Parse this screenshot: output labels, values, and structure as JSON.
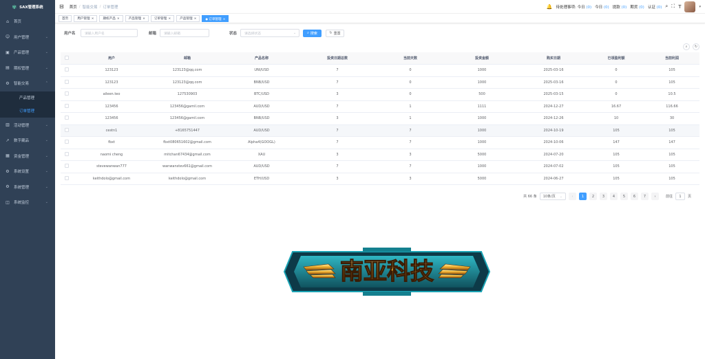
{
  "app": {
    "title": "SAX管理系统"
  },
  "sidebar": {
    "items": [
      {
        "label": "首页",
        "icon": "home-icon",
        "glyph": "⌂"
      },
      {
        "label": "用户管理",
        "icon": "user-icon",
        "glyph": "☺",
        "chevron": "⌄"
      },
      {
        "label": "产品管理",
        "icon": "box-icon",
        "glyph": "▣",
        "chevron": "⌄"
      },
      {
        "label": "期权管理",
        "icon": "chart-icon",
        "glyph": "▤",
        "chevron": "⌄"
      },
      {
        "label": "智能交易",
        "icon": "gear-icon",
        "glyph": "⚙",
        "chevron": "⌃"
      }
    ],
    "subitems": [
      {
        "label": "产品管理",
        "active": false
      },
      {
        "label": "订单管理",
        "active": true
      }
    ],
    "items_after": [
      {
        "label": "活动管理",
        "icon": "gift-icon",
        "glyph": "▥",
        "chevron": "⌄"
      },
      {
        "label": "数字藏品",
        "icon": "trend-icon",
        "glyph": "↗",
        "chevron": "⌄"
      },
      {
        "label": "资金管理",
        "icon": "wallet-icon",
        "glyph": "▦",
        "chevron": "⌄"
      },
      {
        "label": "系统设置",
        "icon": "settings-icon",
        "glyph": "⚙",
        "chevron": "⌄"
      },
      {
        "label": "系统管理",
        "icon": "system-icon",
        "glyph": "⚙",
        "chevron": "⌄"
      },
      {
        "label": "系统监控",
        "icon": "monitor-icon",
        "glyph": "◫",
        "chevron": "⌄"
      }
    ]
  },
  "navbar": {
    "breadcrumb": [
      "首页",
      "智能交易",
      "订单管理"
    ],
    "stats_prefix": "待处理事项: 今日",
    "stats": [
      {
        "label": "今日",
        "value": "(0)"
      },
      {
        "label": "提款",
        "value": "(0)"
      },
      {
        "label": "期货",
        "value": "(0)"
      },
      {
        "label": "认证",
        "value": "(0)"
      }
    ],
    "first_value": "(0)"
  },
  "tags": [
    {
      "label": "首页",
      "active": false,
      "closable": false
    },
    {
      "label": "用户管理",
      "active": false,
      "closable": true
    },
    {
      "label": "期权产品",
      "active": false,
      "closable": true
    },
    {
      "label": "产品管理",
      "active": false,
      "closable": true
    },
    {
      "label": "订单管理",
      "active": false,
      "closable": true
    },
    {
      "label": "产品管理",
      "active": false,
      "closable": true
    },
    {
      "label": "订单管理",
      "active": true,
      "closable": true
    }
  ],
  "filters": {
    "user_label": "用户名",
    "user_placeholder": "请输入用户名",
    "email_label": "邮箱",
    "email_placeholder": "请输入邮箱",
    "status_label": "状态",
    "status_placeholder": "请选择状态",
    "search_label": "搜索",
    "reset_label": "重置"
  },
  "table": {
    "columns": [
      "用户",
      "邮箱",
      "产品名称",
      "投资日期总数",
      "当前天数",
      "投资金额",
      "购买日期",
      "已领盈利额",
      "当前利润"
    ],
    "rows": [
      [
        "123123",
        "123123@qq.com",
        "UNI/USD",
        "7",
        "0",
        "1000",
        "2025-03-16",
        "0",
        "105"
      ],
      [
        "123123",
        "123123@qq.com",
        "BNB/USD",
        "7",
        "0",
        "1000",
        "2025-03-16",
        "0",
        "105"
      ],
      [
        "aileen.teo",
        "127530903",
        "BTC/USD",
        "3",
        "0",
        "500",
        "2025-03-15",
        "0",
        "10.5"
      ],
      [
        "123456",
        "123456@gamil.com",
        "AUD/USD",
        "7",
        "1",
        "1111",
        "2024-12-27",
        "16.67",
        "116.66"
      ],
      [
        "123456",
        "123456@gamil.com",
        "BNB/USD",
        "3",
        "1",
        "1000",
        "2024-12-26",
        "10",
        "30"
      ],
      [
        "cestn1",
        "+8165751447",
        "AUD/USD",
        "7",
        "7",
        "1000",
        "2024-10-19",
        "105",
        "105"
      ],
      [
        "fbxt",
        "fbxt080651602@gmail.com",
        "Alpha4(GOOGL)",
        "7",
        "7",
        "1000",
        "2024-10-06",
        "147",
        "147"
      ],
      [
        "naomi cheng",
        "mitchan67434@gmail.com",
        "XAU",
        "3",
        "3",
        "5000",
        "2024-07-20",
        "105",
        "105"
      ],
      [
        "stevewanwan777",
        "wanwanstev661@gmail.com",
        "AUD/USD",
        "7",
        "7",
        "1000",
        "2024-07-02",
        "105",
        "105"
      ],
      [
        "keithdolo@gmail.com",
        "keithdolo@gmail.com",
        "ETH/USD",
        "3",
        "3",
        "5000",
        "2024-06-27",
        "105",
        "105"
      ]
    ],
    "highlight_row": 5
  },
  "pager": {
    "total": "共 66 条",
    "page_size": "10条/页",
    "pages": [
      "1",
      "2",
      "3",
      "4",
      "5",
      "6",
      "7"
    ],
    "active_page": "1",
    "prev": "‹",
    "next": "›",
    "goto_prefix": "前往",
    "goto_value": "1",
    "goto_suffix": "页"
  },
  "banner": {
    "text": "南亚科技"
  },
  "colors": {
    "sidebar": "#304156",
    "accent": "#409eff",
    "banner_teal": "#1e8c9a",
    "banner_gold": "#f0b030"
  }
}
